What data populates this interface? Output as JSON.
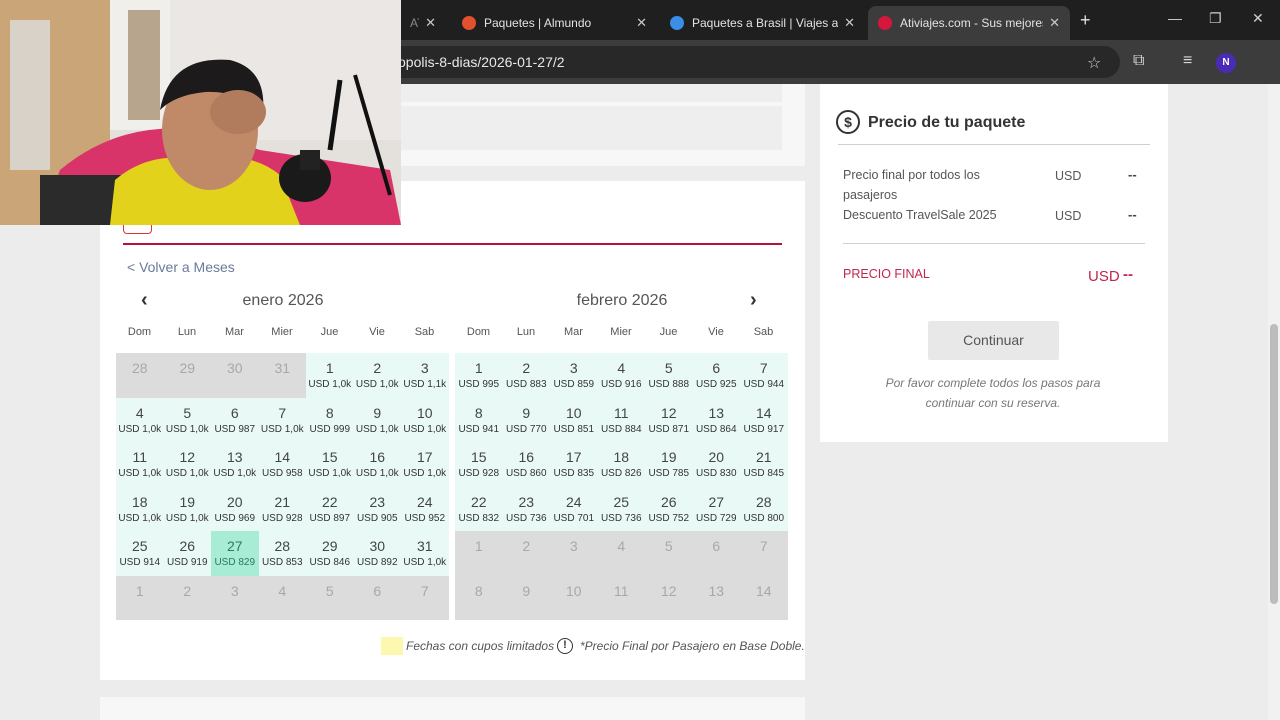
{
  "browser": {
    "tabs": [
      {
        "title": "ATI",
        "fav_color": "#e44"
      },
      {
        "title": "Paquetes | Almundo",
        "fav_color": "#e2512d"
      },
      {
        "title": "Paquetes a Brasil | Viajes a B",
        "fav_color": "#3a8ee6"
      },
      {
        "title": "Ativiajes.com - Sus mejores",
        "fav_color": "#d4183d"
      }
    ],
    "new_tab": "+",
    "url": "opolis-8-dias/2026-01-27/2",
    "profile_initial": "N",
    "win_minimize": "—",
    "win_restore": "❐",
    "win_close": "✕"
  },
  "calendar": {
    "back_link": "< Volver a Meses",
    "months": [
      {
        "title": "enero 2026",
        "dow": [
          "Dom",
          "Lun",
          "Mar",
          "Mier",
          "Jue",
          "Vie",
          "Sab"
        ],
        "weeks": [
          [
            {
              "n": "28",
              "s": "gray"
            },
            {
              "n": "29",
              "s": "gray"
            },
            {
              "n": "30",
              "s": "gray"
            },
            {
              "n": "31",
              "s": "gray"
            },
            {
              "n": "1",
              "p": "USD 1,0k",
              "s": "avail"
            },
            {
              "n": "2",
              "p": "USD 1,0k",
              "s": "avail"
            },
            {
              "n": "3",
              "p": "USD 1,1k",
              "s": "avail"
            }
          ],
          [
            {
              "n": "4",
              "p": "USD 1,0k",
              "s": "avail"
            },
            {
              "n": "5",
              "p": "USD 1,0k",
              "s": "avail"
            },
            {
              "n": "6",
              "p": "USD 987",
              "s": "avail"
            },
            {
              "n": "7",
              "p": "USD 1,0k",
              "s": "avail"
            },
            {
              "n": "8",
              "p": "USD 999",
              "s": "avail"
            },
            {
              "n": "9",
              "p": "USD 1,0k",
              "s": "avail"
            },
            {
              "n": "10",
              "p": "USD 1,0k",
              "s": "avail"
            }
          ],
          [
            {
              "n": "11",
              "p": "USD 1,0k",
              "s": "avail"
            },
            {
              "n": "12",
              "p": "USD 1,0k",
              "s": "avail"
            },
            {
              "n": "13",
              "p": "USD 1,0k",
              "s": "avail"
            },
            {
              "n": "14",
              "p": "USD 958",
              "s": "avail"
            },
            {
              "n": "15",
              "p": "USD 1,0k",
              "s": "avail"
            },
            {
              "n": "16",
              "p": "USD 1,0k",
              "s": "avail"
            },
            {
              "n": "17",
              "p": "USD 1,0k",
              "s": "avail"
            }
          ],
          [
            {
              "n": "18",
              "p": "USD 1,0k",
              "s": "avail"
            },
            {
              "n": "19",
              "p": "USD 1,0k",
              "s": "avail"
            },
            {
              "n": "20",
              "p": "USD 969",
              "s": "avail"
            },
            {
              "n": "21",
              "p": "USD 928",
              "s": "avail"
            },
            {
              "n": "22",
              "p": "USD 897",
              "s": "avail"
            },
            {
              "n": "23",
              "p": "USD 905",
              "s": "avail"
            },
            {
              "n": "24",
              "p": "USD 952",
              "s": "avail"
            }
          ],
          [
            {
              "n": "25",
              "p": "USD 914",
              "s": "avail"
            },
            {
              "n": "26",
              "p": "USD 919",
              "s": "avail"
            },
            {
              "n": "27",
              "p": "USD 829",
              "s": "sel"
            },
            {
              "n": "28",
              "p": "USD 853",
              "s": "avail"
            },
            {
              "n": "29",
              "p": "USD 846",
              "s": "avail"
            },
            {
              "n": "30",
              "p": "USD 892",
              "s": "avail"
            },
            {
              "n": "31",
              "p": "USD 1,0k",
              "s": "avail"
            }
          ],
          [
            {
              "n": "1",
              "s": "gray"
            },
            {
              "n": "2",
              "s": "gray"
            },
            {
              "n": "3",
              "s": "gray"
            },
            {
              "n": "4",
              "s": "gray"
            },
            {
              "n": "5",
              "s": "gray"
            },
            {
              "n": "6",
              "s": "gray"
            },
            {
              "n": "7",
              "s": "gray"
            }
          ]
        ]
      },
      {
        "title": "febrero 2026",
        "dow": [
          "Dom",
          "Lun",
          "Mar",
          "Mier",
          "Jue",
          "Vie",
          "Sab"
        ],
        "weeks": [
          [
            {
              "n": "1",
              "p": "USD 995",
              "s": "avail"
            },
            {
              "n": "2",
              "p": "USD 883",
              "s": "avail"
            },
            {
              "n": "3",
              "p": "USD 859",
              "s": "avail"
            },
            {
              "n": "4",
              "p": "USD 916",
              "s": "avail"
            },
            {
              "n": "5",
              "p": "USD 888",
              "s": "avail"
            },
            {
              "n": "6",
              "p": "USD 925",
              "s": "avail"
            },
            {
              "n": "7",
              "p": "USD 944",
              "s": "avail"
            }
          ],
          [
            {
              "n": "8",
              "p": "USD 941",
              "s": "avail"
            },
            {
              "n": "9",
              "p": "USD 770",
              "s": "avail"
            },
            {
              "n": "10",
              "p": "USD 851",
              "s": "avail"
            },
            {
              "n": "11",
              "p": "USD 884",
              "s": "avail"
            },
            {
              "n": "12",
              "p": "USD 871",
              "s": "avail"
            },
            {
              "n": "13",
              "p": "USD 864",
              "s": "avail"
            },
            {
              "n": "14",
              "p": "USD 917",
              "s": "avail"
            }
          ],
          [
            {
              "n": "15",
              "p": "USD 928",
              "s": "avail"
            },
            {
              "n": "16",
              "p": "USD 860",
              "s": "avail"
            },
            {
              "n": "17",
              "p": "USD 835",
              "s": "avail"
            },
            {
              "n": "18",
              "p": "USD 826",
              "s": "avail"
            },
            {
              "n": "19",
              "p": "USD 785",
              "s": "avail"
            },
            {
              "n": "20",
              "p": "USD 830",
              "s": "avail"
            },
            {
              "n": "21",
              "p": "USD 845",
              "s": "avail"
            }
          ],
          [
            {
              "n": "22",
              "p": "USD 832",
              "s": "avail"
            },
            {
              "n": "23",
              "p": "USD 736",
              "s": "avail"
            },
            {
              "n": "24",
              "p": "USD 701",
              "s": "avail"
            },
            {
              "n": "25",
              "p": "USD 736",
              "s": "avail"
            },
            {
              "n": "26",
              "p": "USD 752",
              "s": "avail"
            },
            {
              "n": "27",
              "p": "USD 729",
              "s": "avail"
            },
            {
              "n": "28",
              "p": "USD 800",
              "s": "avail"
            }
          ],
          [
            {
              "n": "1",
              "s": "gray"
            },
            {
              "n": "2",
              "s": "gray"
            },
            {
              "n": "3",
              "s": "gray"
            },
            {
              "n": "4",
              "s": "gray"
            },
            {
              "n": "5",
              "s": "gray"
            },
            {
              "n": "6",
              "s": "gray"
            },
            {
              "n": "7",
              "s": "gray"
            }
          ],
          [
            {
              "n": "8",
              "s": "gray"
            },
            {
              "n": "9",
              "s": "gray"
            },
            {
              "n": "10",
              "s": "gray"
            },
            {
              "n": "11",
              "s": "gray"
            },
            {
              "n": "12",
              "s": "gray"
            },
            {
              "n": "13",
              "s": "gray"
            },
            {
              "n": "14",
              "s": "gray"
            }
          ]
        ]
      }
    ],
    "legend_limited": "Fechas con cupos limitados",
    "legend_note": "*Precio Final por Pasajero en Base Doble.",
    "legend_swatch_color": "#fdf8b0"
  },
  "price_panel": {
    "title": "Precio de tu paquete",
    "icon": "$",
    "rows": [
      {
        "label": "Precio final por todos los pasajeros",
        "currency": "USD",
        "value": "--"
      },
      {
        "label": "Descuento TravelSale 2025",
        "currency": "USD",
        "value": "--"
      }
    ],
    "final_label": "PRECIO FINAL",
    "final_currency": "USD",
    "final_value": "--",
    "continue_label": "Continuar",
    "help_text": "Por favor complete todos los pasos para continuar con su reserva.",
    "accent_color": "#c0264f"
  }
}
